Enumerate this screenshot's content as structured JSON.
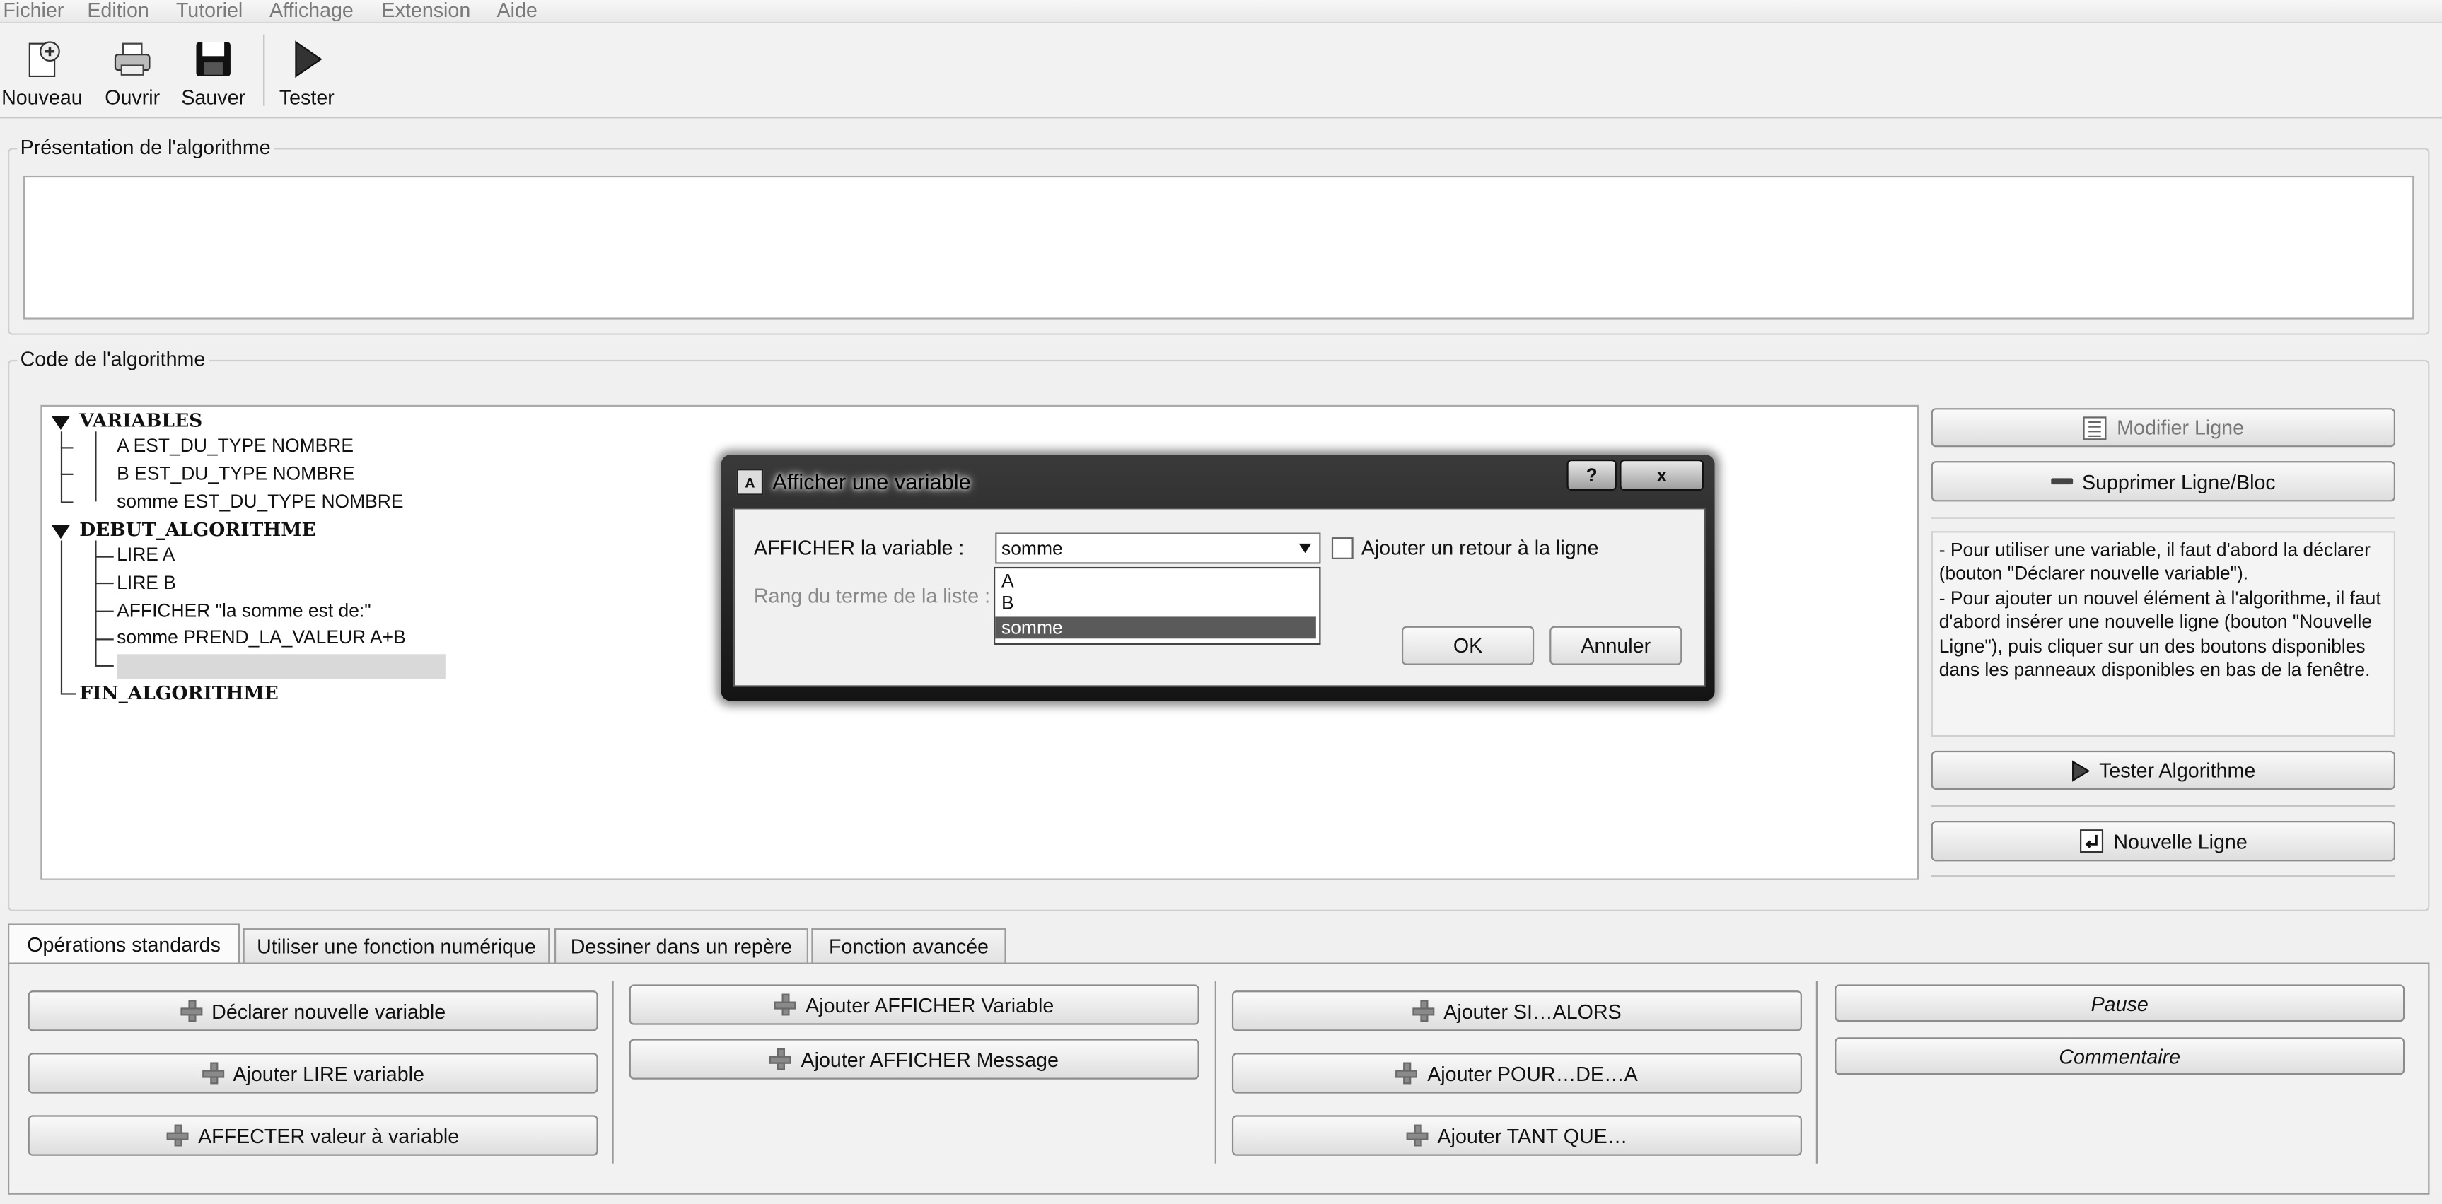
{
  "menu": [
    "Fichier",
    "Edition",
    "Tutoriel",
    "Affichage",
    "Extension",
    "Aide"
  ],
  "toolbar": {
    "new_label": "Nouveau",
    "open_label": "Ouvrir",
    "save_label": "Sauver",
    "test_label": "Tester"
  },
  "presentation": {
    "title": "Présentation de l'algorithme",
    "text": ""
  },
  "code": {
    "title": "Code de l'algorithme",
    "variables_header": "VARIABLES",
    "variables": [
      "A EST_DU_TYPE NOMBRE",
      "B EST_DU_TYPE NOMBRE",
      "somme EST_DU_TYPE NOMBRE"
    ],
    "debut_header": "DEBUT_ALGORITHME",
    "instructions": [
      "LIRE A",
      "LIRE B",
      "AFFICHER \"la somme est de:\"",
      "somme PREND_LA_VALEUR A+B",
      ""
    ],
    "fin_label": "FIN_ALGORITHME"
  },
  "side_panel": {
    "modify_label": "Modifier Ligne",
    "delete_label": "Supprimer Ligne/Bloc",
    "help_text": "- Pour utiliser une variable, il faut d'abord la déclarer (bouton \"Déclarer nouvelle variable\").\n- Pour ajouter un nouvel élément à l'algorithme, il faut d'abord insérer une nouvelle ligne (bouton \"Nouvelle Ligne\"), puis cliquer sur un des boutons disponibles dans les panneaux disponibles en bas de la fenêtre.",
    "test_label": "Tester Algorithme",
    "new_line_label": "Nouvelle Ligne"
  },
  "tabs": [
    "Opérations standards",
    "Utiliser une fonction numérique",
    "Dessiner dans un repère",
    "Fonction avancée"
  ],
  "operations": {
    "declare": "Déclarer nouvelle variable",
    "read": "Ajouter LIRE variable",
    "assign": "AFFECTER valeur à variable",
    "show_var": "Ajouter AFFICHER Variable",
    "show_msg": "Ajouter AFFICHER Message",
    "if": "Ajouter SI…ALORS",
    "for": "Ajouter POUR…DE…A",
    "while": "Ajouter TANT QUE…",
    "pause": "Pause",
    "comment": "Commentaire"
  },
  "dialog": {
    "title": "Afficher une variable",
    "help_btn": "?",
    "close_btn": "x",
    "var_label": "AFFICHER la variable :",
    "selected": "somme",
    "rank_label": "Rang du terme de la liste :",
    "newline_label": "Ajouter un retour à la ligne",
    "newline_checked": false,
    "options": [
      "A",
      "B",
      "somme"
    ],
    "ok": "OK",
    "cancel": "Annuler"
  }
}
